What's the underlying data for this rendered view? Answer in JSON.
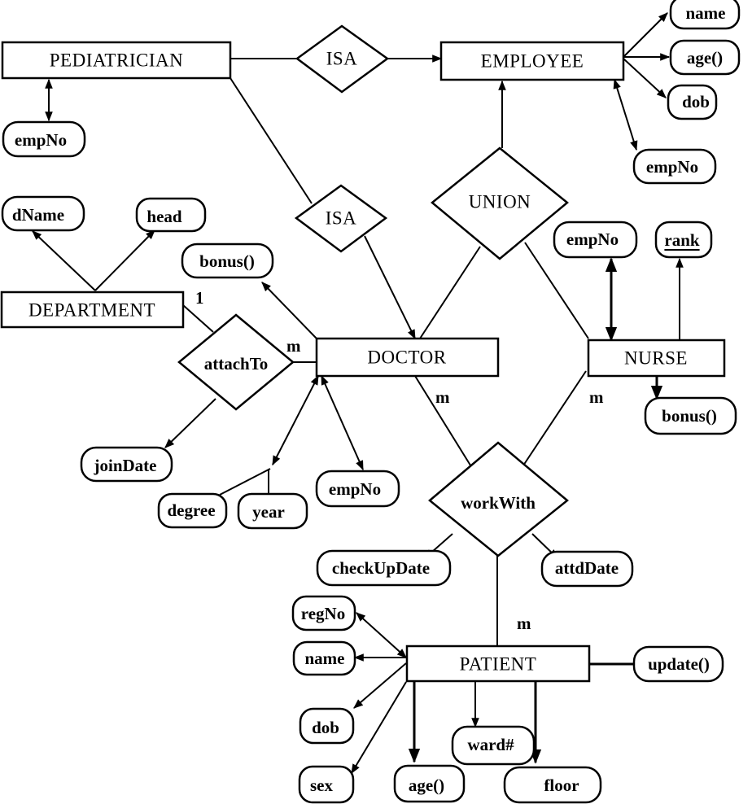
{
  "diagram": {
    "type": "entity-relationship",
    "entities": {
      "pediatrician": "PEDIATRICIAN",
      "employee": "EMPLOYEE",
      "department": "DEPARTMENT",
      "doctor": "DOCTOR",
      "nurse": "NURSE",
      "patient": "PATIENT"
    },
    "relationships": {
      "isa_top": "ISA",
      "isa_mid": "ISA",
      "union": "UNION",
      "attach_to": "attachTo",
      "work_with": "workWith"
    },
    "attributes": {
      "pediatrician_empno": "empNo",
      "employee_name": "name",
      "employee_age": "age()",
      "employee_dob": "dob",
      "employee_empno": "empNo",
      "department_dname": "dName",
      "department_head": "head",
      "doctor_bonus": "bonus()",
      "attach_joindate": "joinDate",
      "doctor_degree": "degree",
      "doctor_year": "year",
      "doctor_empno": "empNo",
      "nurse_empno": "empNo",
      "nurse_rank": "rank",
      "nurse_bonus": "bonus()",
      "work_checkupdate": "checkUpDate",
      "work_attddate": "attdDate",
      "patient_regno": "regNo",
      "patient_name": "name",
      "patient_dob": "dob",
      "patient_sex": "sex",
      "patient_age": "age()",
      "patient_ward": "ward#",
      "patient_floor": "floor",
      "patient_update": "update()"
    },
    "cardinalities": {
      "department_attach": "1",
      "doctor_attach": "m",
      "doctor_work": "m",
      "nurse_work": "m",
      "patient_work": "m"
    }
  }
}
